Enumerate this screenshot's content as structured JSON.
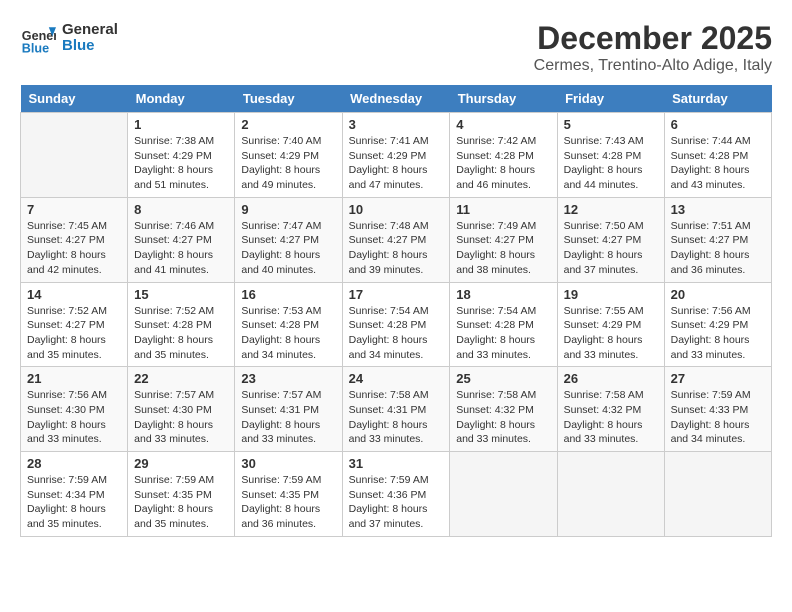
{
  "header": {
    "logo_general": "General",
    "logo_blue": "Blue",
    "month_title": "December 2025",
    "location": "Cermes, Trentino-Alto Adige, Italy"
  },
  "weekdays": [
    "Sunday",
    "Monday",
    "Tuesday",
    "Wednesday",
    "Thursday",
    "Friday",
    "Saturday"
  ],
  "weeks": [
    [
      {
        "day": "",
        "sunrise": "",
        "sunset": "",
        "daylight": ""
      },
      {
        "day": "1",
        "sunrise": "7:38 AM",
        "sunset": "4:29 PM",
        "daylight": "8 hours and 51 minutes."
      },
      {
        "day": "2",
        "sunrise": "7:40 AM",
        "sunset": "4:29 PM",
        "daylight": "8 hours and 49 minutes."
      },
      {
        "day": "3",
        "sunrise": "7:41 AM",
        "sunset": "4:29 PM",
        "daylight": "8 hours and 47 minutes."
      },
      {
        "day": "4",
        "sunrise": "7:42 AM",
        "sunset": "4:28 PM",
        "daylight": "8 hours and 46 minutes."
      },
      {
        "day": "5",
        "sunrise": "7:43 AM",
        "sunset": "4:28 PM",
        "daylight": "8 hours and 44 minutes."
      },
      {
        "day": "6",
        "sunrise": "7:44 AM",
        "sunset": "4:28 PM",
        "daylight": "8 hours and 43 minutes."
      }
    ],
    [
      {
        "day": "7",
        "sunrise": "7:45 AM",
        "sunset": "4:27 PM",
        "daylight": "8 hours and 42 minutes."
      },
      {
        "day": "8",
        "sunrise": "7:46 AM",
        "sunset": "4:27 PM",
        "daylight": "8 hours and 41 minutes."
      },
      {
        "day": "9",
        "sunrise": "7:47 AM",
        "sunset": "4:27 PM",
        "daylight": "8 hours and 40 minutes."
      },
      {
        "day": "10",
        "sunrise": "7:48 AM",
        "sunset": "4:27 PM",
        "daylight": "8 hours and 39 minutes."
      },
      {
        "day": "11",
        "sunrise": "7:49 AM",
        "sunset": "4:27 PM",
        "daylight": "8 hours and 38 minutes."
      },
      {
        "day": "12",
        "sunrise": "7:50 AM",
        "sunset": "4:27 PM",
        "daylight": "8 hours and 37 minutes."
      },
      {
        "day": "13",
        "sunrise": "7:51 AM",
        "sunset": "4:27 PM",
        "daylight": "8 hours and 36 minutes."
      }
    ],
    [
      {
        "day": "14",
        "sunrise": "7:52 AM",
        "sunset": "4:27 PM",
        "daylight": "8 hours and 35 minutes."
      },
      {
        "day": "15",
        "sunrise": "7:52 AM",
        "sunset": "4:28 PM",
        "daylight": "8 hours and 35 minutes."
      },
      {
        "day": "16",
        "sunrise": "7:53 AM",
        "sunset": "4:28 PM",
        "daylight": "8 hours and 34 minutes."
      },
      {
        "day": "17",
        "sunrise": "7:54 AM",
        "sunset": "4:28 PM",
        "daylight": "8 hours and 34 minutes."
      },
      {
        "day": "18",
        "sunrise": "7:54 AM",
        "sunset": "4:28 PM",
        "daylight": "8 hours and 33 minutes."
      },
      {
        "day": "19",
        "sunrise": "7:55 AM",
        "sunset": "4:29 PM",
        "daylight": "8 hours and 33 minutes."
      },
      {
        "day": "20",
        "sunrise": "7:56 AM",
        "sunset": "4:29 PM",
        "daylight": "8 hours and 33 minutes."
      }
    ],
    [
      {
        "day": "21",
        "sunrise": "7:56 AM",
        "sunset": "4:30 PM",
        "daylight": "8 hours and 33 minutes."
      },
      {
        "day": "22",
        "sunrise": "7:57 AM",
        "sunset": "4:30 PM",
        "daylight": "8 hours and 33 minutes."
      },
      {
        "day": "23",
        "sunrise": "7:57 AM",
        "sunset": "4:31 PM",
        "daylight": "8 hours and 33 minutes."
      },
      {
        "day": "24",
        "sunrise": "7:58 AM",
        "sunset": "4:31 PM",
        "daylight": "8 hours and 33 minutes."
      },
      {
        "day": "25",
        "sunrise": "7:58 AM",
        "sunset": "4:32 PM",
        "daylight": "8 hours and 33 minutes."
      },
      {
        "day": "26",
        "sunrise": "7:58 AM",
        "sunset": "4:32 PM",
        "daylight": "8 hours and 33 minutes."
      },
      {
        "day": "27",
        "sunrise": "7:59 AM",
        "sunset": "4:33 PM",
        "daylight": "8 hours and 34 minutes."
      }
    ],
    [
      {
        "day": "28",
        "sunrise": "7:59 AM",
        "sunset": "4:34 PM",
        "daylight": "8 hours and 35 minutes."
      },
      {
        "day": "29",
        "sunrise": "7:59 AM",
        "sunset": "4:35 PM",
        "daylight": "8 hours and 35 minutes."
      },
      {
        "day": "30",
        "sunrise": "7:59 AM",
        "sunset": "4:35 PM",
        "daylight": "8 hours and 36 minutes."
      },
      {
        "day": "31",
        "sunrise": "7:59 AM",
        "sunset": "4:36 PM",
        "daylight": "8 hours and 37 minutes."
      },
      {
        "day": "",
        "sunrise": "",
        "sunset": "",
        "daylight": ""
      },
      {
        "day": "",
        "sunrise": "",
        "sunset": "",
        "daylight": ""
      },
      {
        "day": "",
        "sunrise": "",
        "sunset": "",
        "daylight": ""
      }
    ]
  ],
  "labels": {
    "sunrise_prefix": "Sunrise: ",
    "sunset_prefix": "Sunset: ",
    "daylight_prefix": "Daylight: "
  }
}
